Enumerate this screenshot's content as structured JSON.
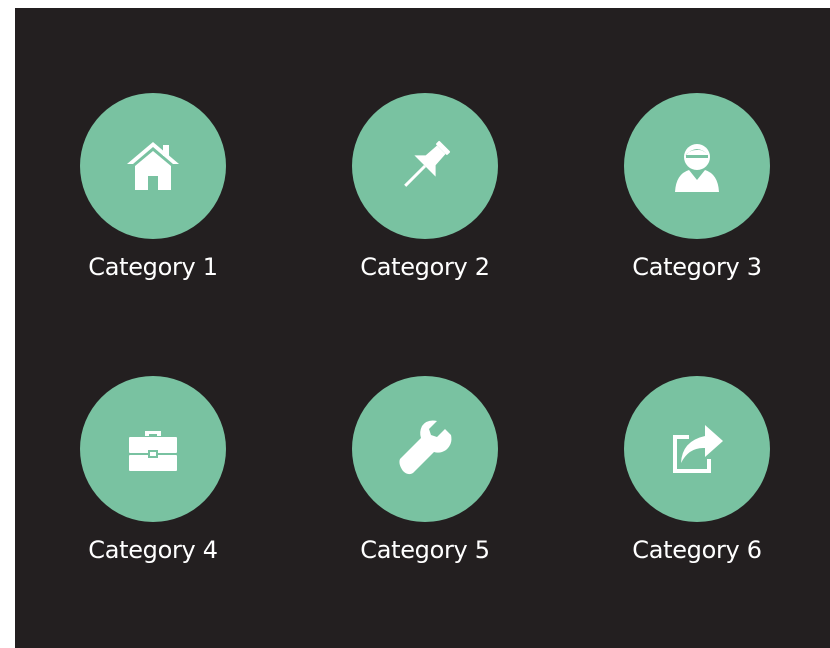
{
  "theme": {
    "background": "#231f20",
    "accent": "#79c2a1",
    "text": "#ffffff"
  },
  "categories": [
    {
      "label": "Category 1",
      "icon": "home-icon"
    },
    {
      "label": "Category 2",
      "icon": "pushpin-icon"
    },
    {
      "label": "Category 3",
      "icon": "user-icon"
    },
    {
      "label": "Category 4",
      "icon": "briefcase-icon"
    },
    {
      "label": "Category 5",
      "icon": "wrench-icon"
    },
    {
      "label": "Category 6",
      "icon": "share-icon"
    }
  ]
}
